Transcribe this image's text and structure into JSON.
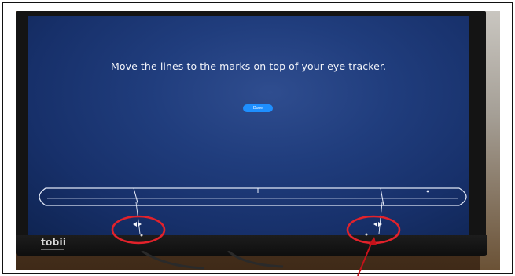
{
  "screen": {
    "instruction": "Move the lines to the marks on top of your eye tracker.",
    "done_label": "Done"
  },
  "device": {
    "brand": "tobii"
  },
  "colors": {
    "screen_background": "#1b3674",
    "done_button": "#1e8fff",
    "annotation_circle": "#e2222b",
    "annotation_arrow": "#c4121a"
  },
  "icons": {
    "left_handle": "left-right-arrow-icon",
    "right_handle": "left-right-arrow-icon"
  }
}
